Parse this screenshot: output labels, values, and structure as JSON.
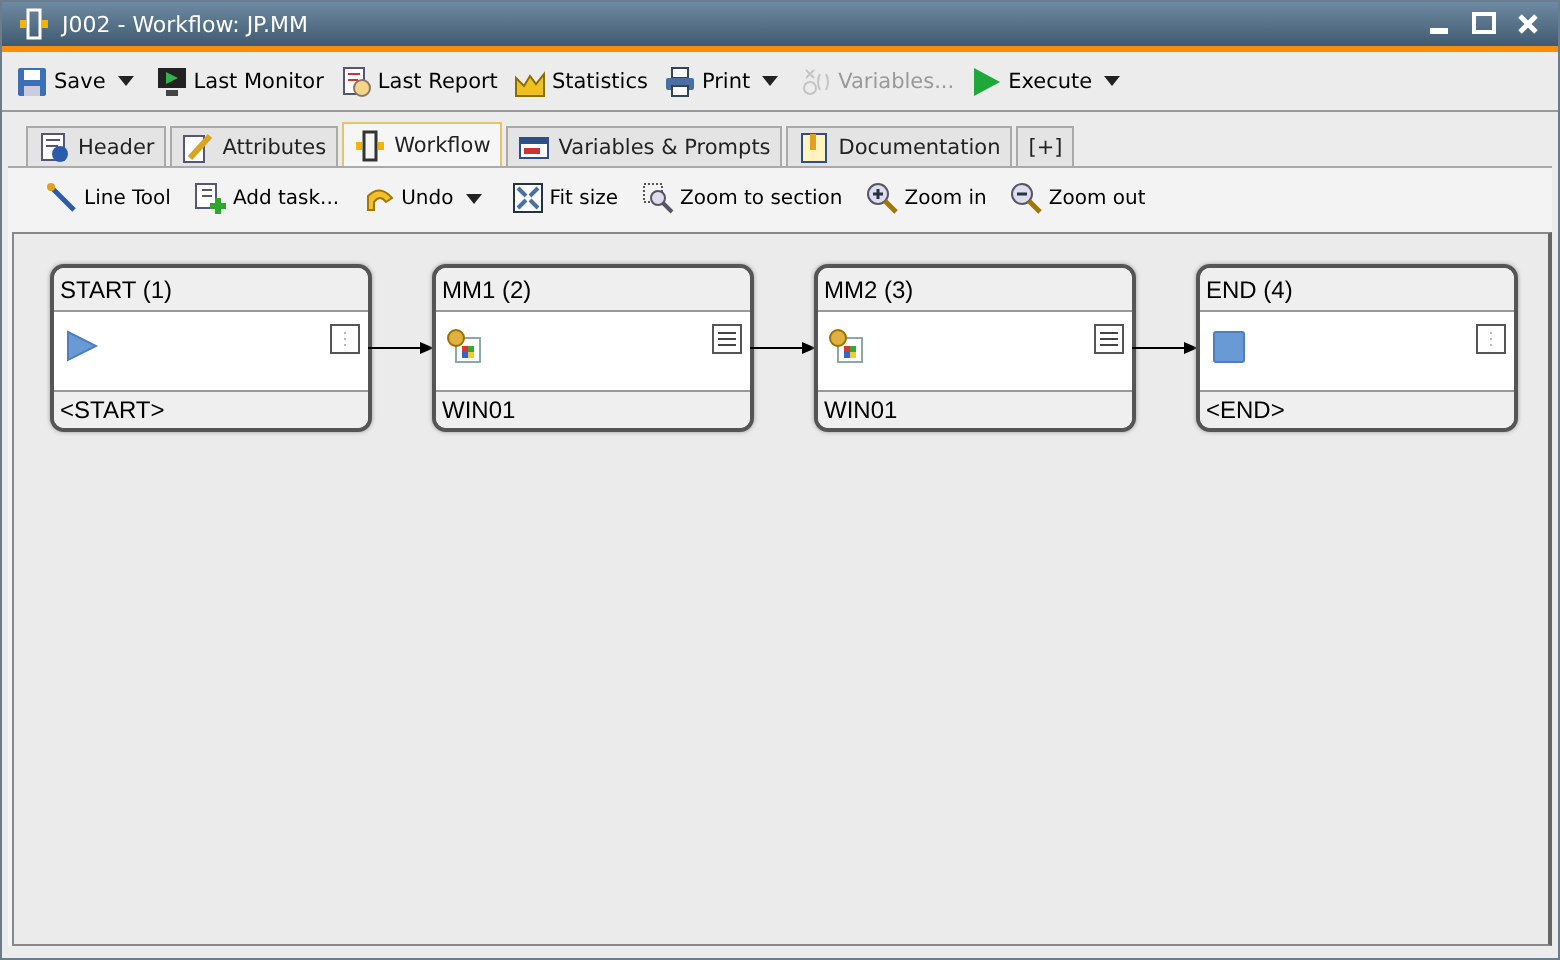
{
  "window": {
    "title": "J002 - Workflow: JP.MM"
  },
  "toolbar": [
    {
      "label": "Save",
      "dropdown": true,
      "disabled": false
    },
    {
      "label": "Last Monitor",
      "dropdown": false,
      "disabled": false
    },
    {
      "label": "Last Report",
      "dropdown": false,
      "disabled": false
    },
    {
      "label": "Statistics",
      "dropdown": false,
      "disabled": false
    },
    {
      "label": "Print",
      "dropdown": true,
      "disabled": false
    },
    {
      "label": "Variables...",
      "dropdown": false,
      "disabled": true
    },
    {
      "label": "Execute",
      "dropdown": true,
      "disabled": false
    }
  ],
  "tabs": [
    {
      "label": "Header",
      "selected": false
    },
    {
      "label": "Attributes",
      "selected": false
    },
    {
      "label": "Workflow",
      "selected": true
    },
    {
      "label": "Variables & Prompts",
      "selected": false
    },
    {
      "label": "Documentation",
      "selected": false
    },
    {
      "label": "[+]",
      "selected": false
    }
  ],
  "workflow_toolbar": [
    {
      "label": "Line Tool",
      "dropdown": false
    },
    {
      "label": "Add task...",
      "dropdown": false
    },
    {
      "label": "Undo",
      "dropdown": true
    },
    {
      "label": "Fit size",
      "dropdown": false
    },
    {
      "label": "Zoom to section",
      "dropdown": false
    },
    {
      "label": "Zoom in",
      "dropdown": false
    },
    {
      "label": "Zoom out",
      "dropdown": false
    }
  ],
  "nodes": [
    {
      "title": "START (1)",
      "kind": "start",
      "footer": "<START>"
    },
    {
      "title": "MM1 (2)",
      "kind": "task",
      "footer": "WIN01"
    },
    {
      "title": "MM2 (3)",
      "kind": "task",
      "footer": "WIN01"
    },
    {
      "title": "END (4)",
      "kind": "end",
      "footer": "<END>"
    }
  ]
}
